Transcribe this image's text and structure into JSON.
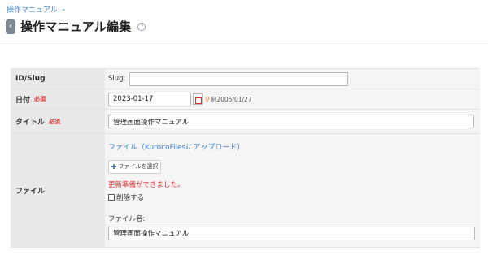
{
  "breadcrumb": {
    "label": "操作マニュアル"
  },
  "header": {
    "title": "操作マニュアル編集"
  },
  "form": {
    "id_slug": {
      "label": "ID/Slug",
      "slug_label": "Slug:",
      "slug_value": ""
    },
    "date": {
      "label": "日付",
      "required": "必須",
      "value": "2023-01-17",
      "example": "例2005/01/27"
    },
    "title": {
      "label": "タイトル",
      "required": "必須",
      "value": "管理画面操作マニュアル"
    },
    "file": {
      "label": "ファイル",
      "link": "ファイル（KurocoFilesにアップロード）",
      "select_button": "ファイルを選択",
      "status": "更新準備ができました。",
      "delete_label": "削除する",
      "filename_label": "ファイル名:",
      "filename_value": "管理画面操作マニュアル"
    }
  }
}
